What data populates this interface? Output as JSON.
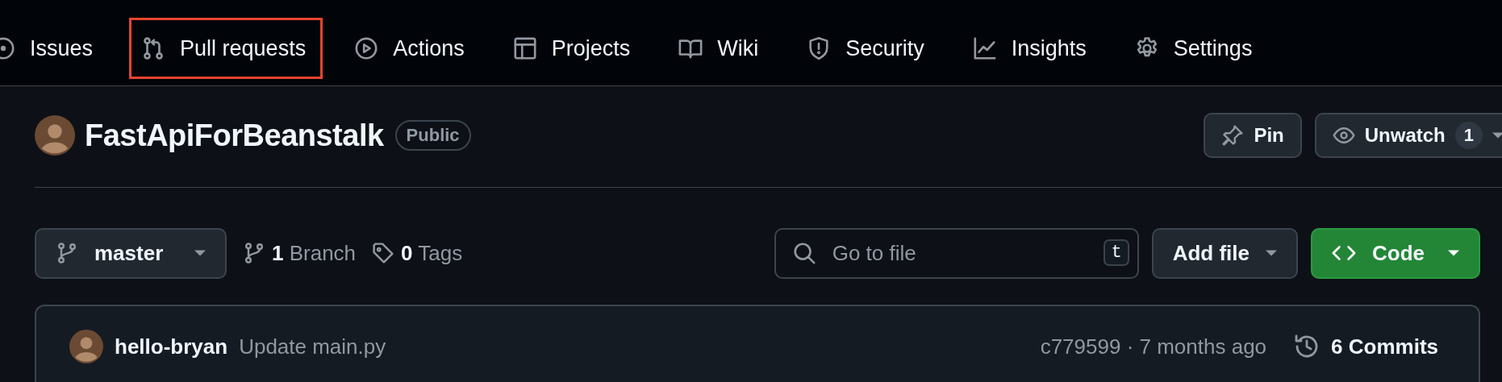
{
  "nav": {
    "items": [
      {
        "label": "Issues",
        "highlighted": false
      },
      {
        "label": "Pull requests",
        "highlighted": true
      },
      {
        "label": "Actions",
        "highlighted": false
      },
      {
        "label": "Projects",
        "highlighted": false
      },
      {
        "label": "Wiki",
        "highlighted": false
      },
      {
        "label": "Security",
        "highlighted": false
      },
      {
        "label": "Insights",
        "highlighted": false
      },
      {
        "label": "Settings",
        "highlighted": false
      }
    ]
  },
  "repo": {
    "name": "FastApiForBeanstalk",
    "visibility": "Public",
    "actions": [
      {
        "kind": "pin",
        "label": "Pin"
      },
      {
        "kind": "watch",
        "label": "Unwatch",
        "count": "1"
      }
    ]
  },
  "toolbar": {
    "branch": "master",
    "branches": "**1** Branch",
    "tags": "**0** Tags",
    "search": {
      "placeholder": "Go to file",
      "shortcut": "t"
    },
    "add_file": "Add file",
    "code": "Code"
  },
  "latest_commit": {
    "author": "hello-bryan",
    "message": "Update main.py",
    "meta": "c779599 · 7 months ago",
    "commits": "6 Commits"
  }
}
